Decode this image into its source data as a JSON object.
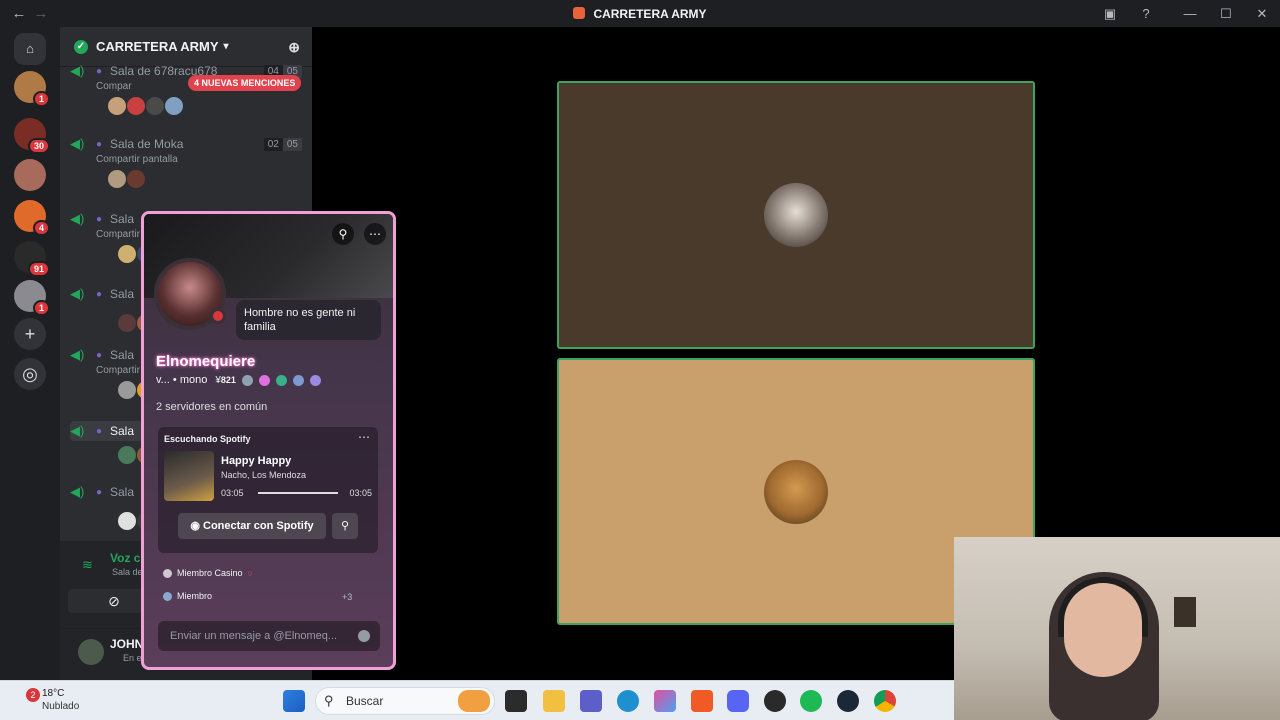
{
  "window": {
    "title": "CARRETERA ARMY"
  },
  "server_rail": {
    "badges": [
      "1",
      "30",
      "4",
      "91",
      "1"
    ]
  },
  "guild": {
    "name": "CARRETERA ARMY"
  },
  "channels": [
    {
      "name": "Sala de 678racu678",
      "sub": "Compar",
      "lim_a": "04",
      "lim_b": "05"
    },
    {
      "name": "Sala de Moka",
      "sub": "Compartir pantalla",
      "lim_a": "02",
      "lim_b": "05"
    },
    {
      "name": "Sala",
      "sub": "Compartir"
    },
    {
      "name": "Sala"
    },
    {
      "name": "Sala",
      "sub": "Compartir"
    },
    {
      "name": "Sala"
    },
    {
      "name": "Sala"
    }
  ],
  "mentions_pill": "4 NUEVAS MENCIONES",
  "voice": {
    "title": "Voz conectada",
    "channel": "Sala de sexito / C"
  },
  "user": {
    "name": "JOHN CENA FR",
    "status": "En el canal de voz"
  },
  "profile": {
    "bubble": "Hombre no es gente ni familia",
    "display_name": "Elnomequiere",
    "tagline": "v... • mono",
    "tag_count": "821",
    "mutual": "2 servidores en común",
    "spotify": {
      "header": "Escuchando Spotify",
      "song": "Happy Happy",
      "artist": "Nacho, Los Mendoza",
      "elapsed": "03:05",
      "total": "03:05",
      "progress": 1.0,
      "connect": "Conectar con Spotify"
    },
    "roles": [
      "Miembro Casino",
      "Miembro"
    ],
    "more_roles": "+3",
    "message_placeholder": "Enviar un mensaje a @Elnomeq..."
  },
  "taskbar": {
    "weather_badge": "2",
    "temp": "18°C",
    "condition": "Nublado",
    "search": "Buscar"
  },
  "colors": {
    "tile_top": "#4a3a2b",
    "tile_bottom": "#c9a06b",
    "speaking": "#3ba55d",
    "popout_border": "#f0a0d6"
  }
}
